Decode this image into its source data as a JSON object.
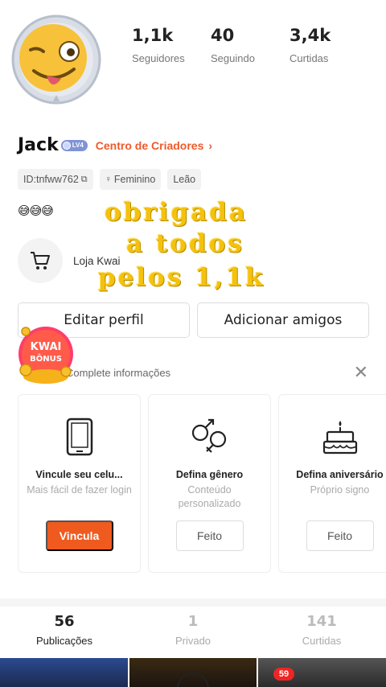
{
  "profile": {
    "name": "Jack",
    "level_badge": "LV4",
    "creator_center_label": "Centro de Criadores",
    "emojis": "😅😅😅"
  },
  "stats": [
    {
      "value": "1,1k",
      "label": "Seguidores"
    },
    {
      "value": "40",
      "label": "Seguindo"
    },
    {
      "value": "3,4k",
      "label": "Curtidas"
    }
  ],
  "tags": {
    "id": "ID:tnfww762",
    "gender": "Feminino",
    "sign": "Leão"
  },
  "overlay": {
    "line1": "obrigada",
    "line2": "a todos",
    "line3": "pelos 1,1k"
  },
  "shop": {
    "label": "Loja Kwai"
  },
  "actions": {
    "edit_profile": "Editar perfil",
    "add_friends": "Adicionar amigos"
  },
  "bonus": {
    "line1": "KWAI",
    "line2": "BÔNUS"
  },
  "info": {
    "title": "Complete informações",
    "cards": [
      {
        "title": "Vincule seu celu...",
        "subtitle": "Mais fácil de fazer login",
        "button": "Vincula"
      },
      {
        "title": "Defina gênero",
        "subtitle": "Conteúdo personalizado",
        "button": "Feito"
      },
      {
        "title": "Defina aniversário",
        "subtitle": "Próprio signo",
        "button": "Feito"
      }
    ]
  },
  "tabs": [
    {
      "value": "56",
      "label": "Publicações"
    },
    {
      "value": "1",
      "label": "Privado"
    },
    {
      "value": "141",
      "label": "Curtidas"
    }
  ],
  "nav": {
    "badge": "59"
  },
  "colors": {
    "accent": "#ef5a2a",
    "button_primary": "#ef5a1f",
    "overlay_text": "#f4c20d",
    "badge_red": "#f02424"
  }
}
